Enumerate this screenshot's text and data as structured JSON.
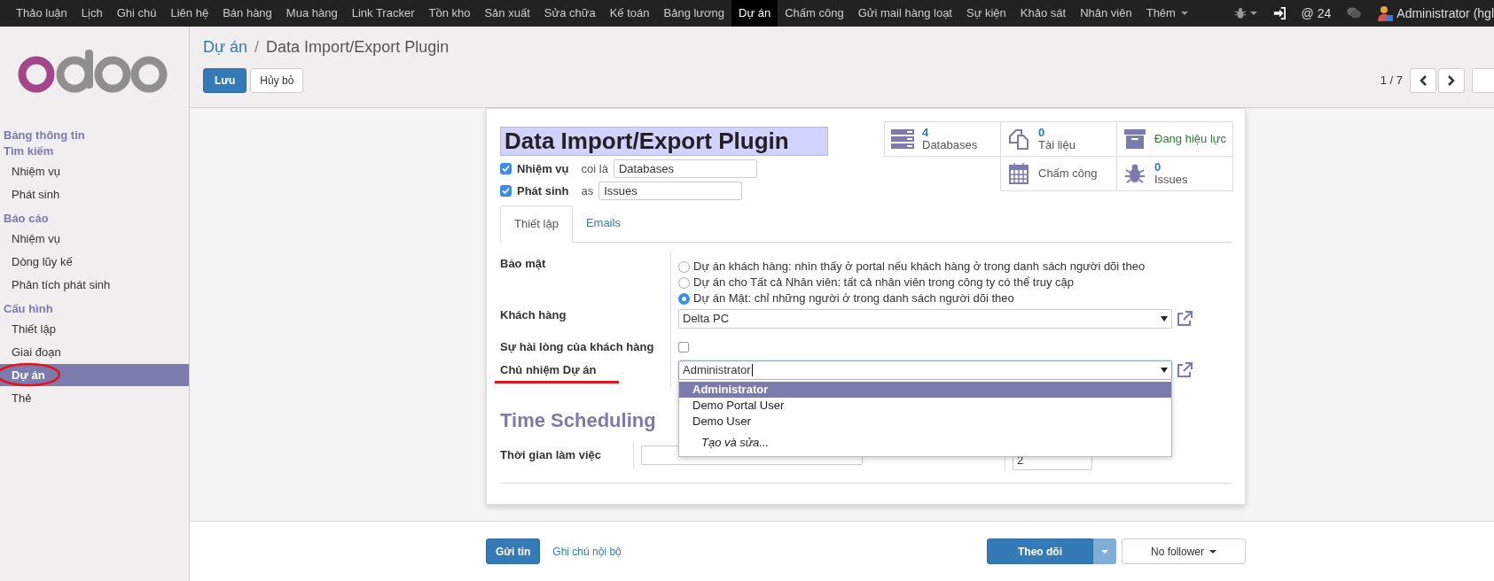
{
  "top_menu": [
    {
      "label": "Thảo luận",
      "selected": false
    },
    {
      "label": "Lịch",
      "selected": false
    },
    {
      "label": "Ghi chú",
      "selected": false
    },
    {
      "label": "Liên hệ",
      "selected": false
    },
    {
      "label": "Bán hàng",
      "selected": false
    },
    {
      "label": "Mua hàng",
      "selected": false
    },
    {
      "label": "Link Tracker",
      "selected": false
    },
    {
      "label": "Tồn kho",
      "selected": false
    },
    {
      "label": "Sản xuất",
      "selected": false
    },
    {
      "label": "Sửa chữa",
      "selected": false
    },
    {
      "label": "Kế toán",
      "selected": false
    },
    {
      "label": "Bảng lương",
      "selected": false
    },
    {
      "label": "Dự án",
      "selected": true
    },
    {
      "label": "Chấm công",
      "selected": false
    },
    {
      "label": "Gửi mail hàng loạt",
      "selected": false
    },
    {
      "label": "Sự kiện",
      "selected": false
    },
    {
      "label": "Khảo sát",
      "selected": false
    },
    {
      "label": "Nhân viên",
      "selected": false
    }
  ],
  "more_menu": "Thêm",
  "systray": {
    "mentions": "@ 24",
    "user": "Administrator (hgl"
  },
  "sidebar": [
    {
      "title": "Bảng thông tin"
    },
    {
      "title": "Tìm kiếm",
      "items": [
        {
          "label": "Nhiệm vụ",
          "selected": false
        },
        {
          "label": "Phát sinh",
          "selected": false
        }
      ]
    },
    {
      "title": "Báo cáo",
      "items": [
        {
          "label": "Nhiệm vụ",
          "selected": false
        },
        {
          "label": "Dòng lũy kế",
          "selected": false
        },
        {
          "label": "Phân tích phát sinh",
          "selected": false
        }
      ]
    },
    {
      "title": "Cấu hình",
      "items": [
        {
          "label": "Thiết lập",
          "selected": false
        },
        {
          "label": "Giai đoạn",
          "selected": false
        },
        {
          "label": "Dự án",
          "selected": true
        },
        {
          "label": "Thẻ",
          "selected": false
        }
      ]
    }
  ],
  "breadcrumb": {
    "parent": "Dự án",
    "separator": "/",
    "current": "Data Import/Export Plugin"
  },
  "buttons": {
    "save": "Lưu",
    "discard": "Hủy bỏ"
  },
  "pager": "1 / 7",
  "form": {
    "title": "Data Import/Export Plugin",
    "alias_rows": [
      {
        "checked": true,
        "label": "Nhiệm vụ",
        "connector": "coi là",
        "value": "Databases"
      },
      {
        "checked": true,
        "label": "Phát sinh",
        "connector": "as",
        "value": "Issues"
      }
    ],
    "stat_rows": [
      [
        {
          "kind": "databases",
          "value": "4",
          "label": "Databases"
        },
        {
          "kind": "documents",
          "value": "0",
          "label": "Tài liệu"
        },
        {
          "kind": "status",
          "label": "Đang hiệu lực"
        }
      ],
      [
        {
          "kind": "timesheet",
          "label": "Chấm công"
        },
        {
          "kind": "issues",
          "value": "0",
          "label": "Issues"
        }
      ]
    ],
    "tabs": [
      {
        "label": "Thiết lập",
        "selected": true
      },
      {
        "label": "Emails",
        "selected": false
      }
    ],
    "privacy": {
      "label": "Bảo mật",
      "options": [
        {
          "label": "Dự án khách hàng: nhìn thấy ở portal nếu khách hàng ở trong danh sách người dõi theo",
          "selected": false
        },
        {
          "label": "Dự án cho Tất cả Nhân viên: tất cả nhân viên trong công ty có thể truy cập",
          "selected": false
        },
        {
          "label": "Dự án Mật: chỉ những người ở trong danh sách người dõi theo",
          "selected": true
        }
      ]
    },
    "customer": {
      "label": "Khách hàng",
      "value": "Delta PC"
    },
    "satisfaction": {
      "label": "Sự hài lòng của khách hàng",
      "checked": false
    },
    "manager": {
      "label": "Chủ nhiệm Dự án",
      "value": "Administrator",
      "options": [
        {
          "label": "Administrator",
          "selected": true
        },
        {
          "label": "Demo Portal User",
          "selected": false
        },
        {
          "label": "Demo User",
          "selected": false
        }
      ],
      "create": "Tạo và sửa..."
    },
    "section_title": "Time Scheduling",
    "working_time": {
      "label": "Thời gian làm việc",
      "sequence": "2"
    }
  },
  "chatter": {
    "send": "Gửi tin",
    "note": "Ghi chú nội bộ",
    "follow": "Theo dõi",
    "followers": "No follower"
  }
}
